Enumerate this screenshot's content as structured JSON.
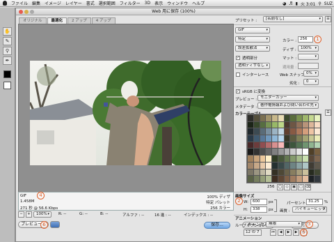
{
  "menubar": {
    "items": [
      "ファイル",
      "編集",
      "イメージ",
      "レイヤー",
      "書式",
      "選択範囲",
      "フィルター",
      "3D",
      "表示",
      "ウィンドウ",
      "ヘルプ"
    ],
    "clock": "火 3:01",
    "user": "SUZ"
  },
  "dialog": {
    "title": "Web 用に保存 (100%)",
    "tabs": [
      {
        "label": "オリジナル"
      },
      {
        "label": "最適化"
      },
      {
        "label": "2 アップ"
      },
      {
        "label": "4 アップ"
      }
    ]
  },
  "preview": {
    "format": "GIF",
    "size": "1.458M",
    "time": "271 秒 @ 56.6 Kbps",
    "dither": "100% ディザ",
    "palette": "特定 パレット",
    "colors": "256 カラー",
    "zoom": "100%",
    "r": "R: --",
    "g": "G: --",
    "b": "B: --",
    "alpha": "アルファ : --",
    "hex": "16 進 : --",
    "index": "インデックス : --"
  },
  "settings": {
    "preset_label": "プリセット :",
    "preset_value": "[名前なし]",
    "format": "GIF",
    "reduction": "特定",
    "colors_label": "カラー :",
    "colors_value": "256",
    "dither_algo": "誤差拡散法",
    "dither_label": "ディザ :",
    "dither_value": "100%",
    "transparency_label": "透明部分",
    "matte_label": "マット :",
    "matte_dither": "透明ディザなし",
    "amount_label": "適用量 :",
    "interlace_label": "インターレース",
    "websnap_label": "Web スナップ :",
    "websnap_value": "0%",
    "lossy_label": "劣化 :",
    "lossy_value": "0",
    "srgb_label": "sRGB に変換",
    "preview_label": "プレビュー :",
    "preview_value": "モニターカラー",
    "metadata_label": "メタデータ :",
    "metadata_value": "著作権情報および問い合わせ先",
    "color_table_label": "カラーテーブル",
    "color_count": "256"
  },
  "image_size": {
    "label": "画像サイズ",
    "w_label": "W:",
    "w_value": "600",
    "h_label": "H:",
    "h_value": "338",
    "unit": "px",
    "percent_label": "パーセント :",
    "percent_value": "31.25",
    "percent_unit": "%",
    "quality_label": "画質 :",
    "quality_value": "バイキュービック法"
  },
  "animation": {
    "label": "アニメーション",
    "loop_label": "ループオプション :",
    "loop_value": "無限",
    "frame": "12 の 7"
  },
  "buttons": {
    "preview": "プレビュー...",
    "save": "保存...",
    "cancel": "キャンセル",
    "done": "完了"
  },
  "callouts": [
    "1",
    "2",
    "3",
    "4",
    "5",
    "6"
  ],
  "colors": {
    "accent": "#e0602a",
    "primary_button": "#6fa6e3"
  },
  "palette_colors": [
    "#2e2e2a",
    "#55503c",
    "#7a6f50",
    "#a2946c",
    "#c8b88a",
    "#e8dcb4",
    "#3c4a2c",
    "#5a6e3c",
    "#7c9450",
    "#a0b86c",
    "#c4d890",
    "#e8f4c0",
    "#1c2418",
    "#38482c",
    "#566e40",
    "#789454",
    "#98b868",
    "#bcd888",
    "#4a3a2e",
    "#6e5644",
    "#92725a",
    "#b8947a",
    "#dcb69a",
    "#f8dcc4",
    "#20282c",
    "#3c4a52",
    "#5a6c78",
    "#7a90a0",
    "#9cb4c4",
    "#c4d8e4",
    "#604030",
    "#885a44",
    "#b07a5c",
    "#d49e7c",
    "#eec4a4",
    "#fce8d4",
    "#2a3a48",
    "#405a70",
    "#587898",
    "#7098bc",
    "#90b8d8",
    "#b8d8f0",
    "#383828",
    "#5c5c40",
    "#808058",
    "#a4a474",
    "#c8c894",
    "#ececb8",
    "#482828",
    "#6c3c3c",
    "#904e50",
    "#b46c6c",
    "#d89090",
    "#f8b8b8",
    "#283828",
    "#3c563c",
    "#547454",
    "#709470",
    "#90b490",
    "#b4d4b4",
    "#1a1a1a",
    "#333333",
    "#4d4d4d",
    "#666666",
    "#808080",
    "#999999",
    "#b3b3b3",
    "#cccccc",
    "#e6e6e6",
    "#ffffff",
    "#504028",
    "#786040",
    "#a0805c",
    "#c8a47c",
    "#ecc89c",
    "#fff0c8",
    "#303c24",
    "#48583a",
    "#647850",
    "#849a6c",
    "#a6bc8c",
    "#cae0b0",
    "#5a4838",
    "#7e6650",
    "#a2866a",
    "#c6a888",
    "#e8caaa",
    "#fcecd4",
    "#243030",
    "#3a4a4a",
    "#526666",
    "#6e8484",
    "#8ca4a4",
    "#aec6c6",
    "#403c34",
    "#5e584c",
    "#7c7666",
    "#9c9682",
    "#beb8a2",
    "#e0dac4",
    "#343024",
    "#4e4836",
    "#6a624a",
    "#887e60",
    "#a89e7c",
    "#cac09c",
    "#282c20",
    "#404632",
    "#5a6246",
    "#767e5e",
    "#949e78",
    "#b4be96",
    "#3e2e22",
    "#5e4634",
    "#7e6048",
    "#a07c60",
    "#c29c7c",
    "#e4bea0",
    "#1e2226",
    "#32383e",
    "#4a5258",
    "#646e76",
    "#808c96",
    "#9eaab6",
    "#46443a",
    "#666256",
    "#888474",
    "#aaa696",
    "#ccc8ba",
    "#eeeade",
    "#2c2818",
    "#443e28",
    "#5e563c",
    "#7a7052",
    "#988c6a",
    "#b8aa86"
  ]
}
